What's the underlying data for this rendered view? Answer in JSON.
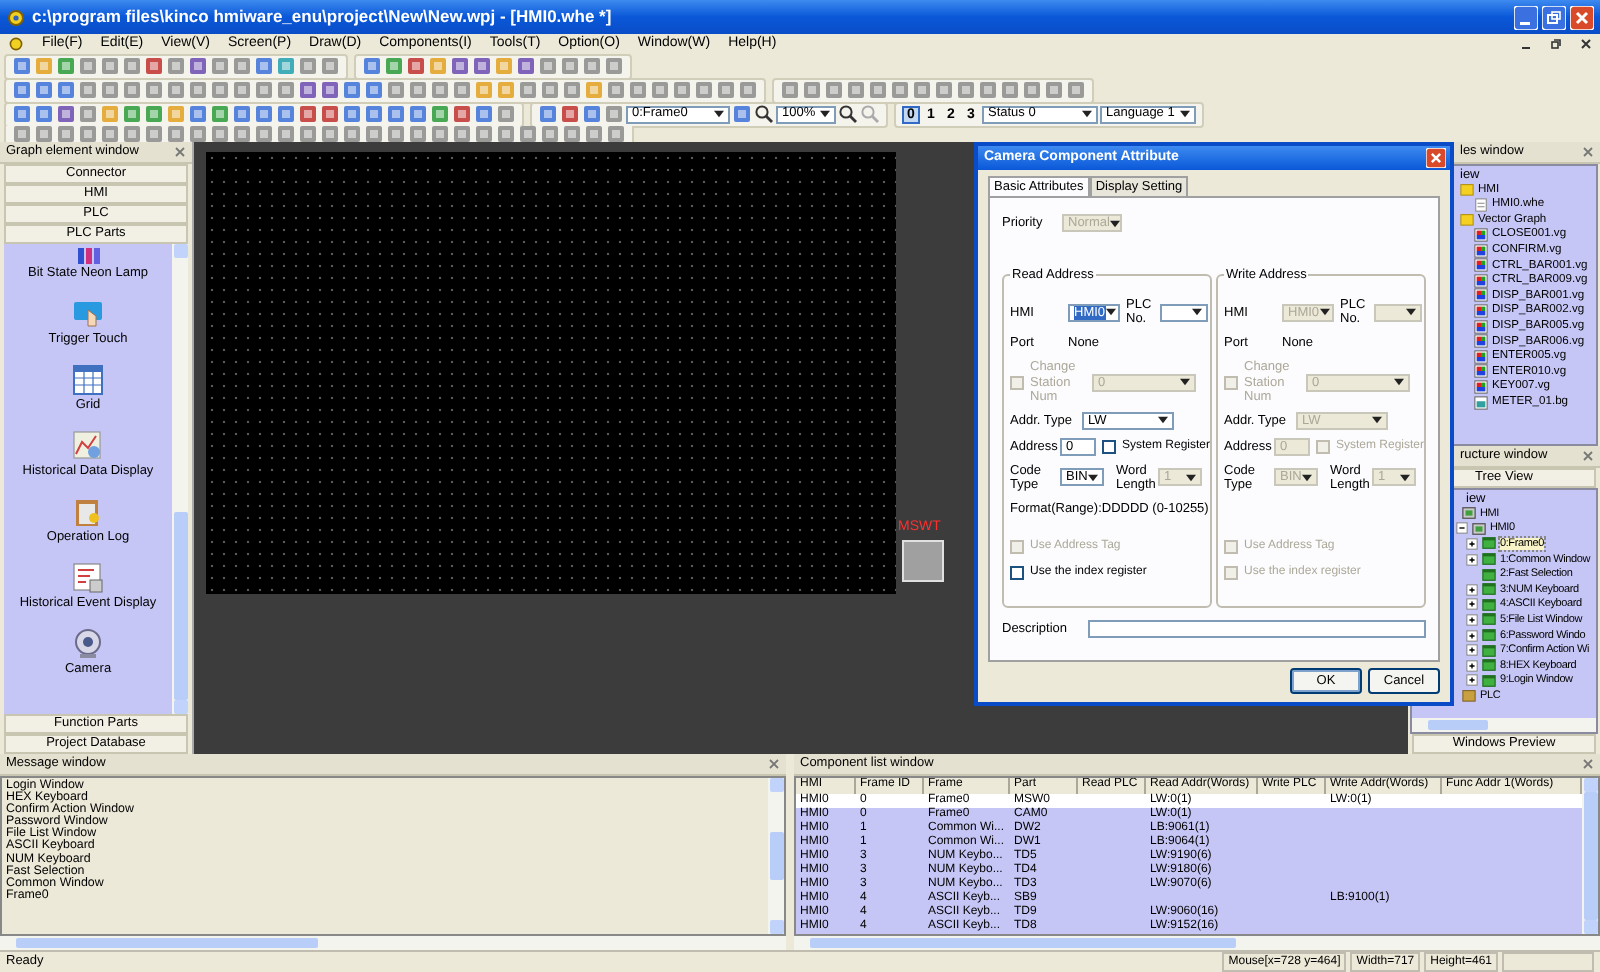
{
  "window": {
    "title": "c:\\program files\\kinco hmiware_enu\\project\\New\\New.wpj - [HMI0.whe *]"
  },
  "menu": [
    "File(F)",
    "Edit(E)",
    "View(V)",
    "Screen(P)",
    "Draw(D)",
    "Components(I)",
    "Tools(T)",
    "Option(O)",
    "Window(W)",
    "Help(H)"
  ],
  "toolbar": {
    "frame_select": "0:Frame0",
    "zoom_select": "100%",
    "layers": [
      {
        "label": "0",
        "selected": true
      },
      {
        "label": "1",
        "selected": false
      },
      {
        "label": "2",
        "selected": false
      },
      {
        "label": "3",
        "selected": false
      }
    ],
    "status_select": "Status 0",
    "language_select": "Language 1"
  },
  "graph_element_window": {
    "title": "Graph element window",
    "sections_top": [
      {
        "label": "Connector"
      },
      {
        "label": "HMI"
      },
      {
        "label": "PLC"
      },
      {
        "label": "PLC Parts"
      }
    ],
    "items": [
      {
        "label": "Bit State Neon Lamp"
      },
      {
        "label": "Trigger Touch"
      },
      {
        "label": "Grid"
      },
      {
        "label": "Historical Data Display"
      },
      {
        "label": "Operation Log"
      },
      {
        "label": "Historical Event Display"
      },
      {
        "label": "Camera"
      }
    ],
    "sections_bottom": [
      {
        "label": "Function Parts"
      },
      {
        "label": "Project Database"
      }
    ]
  },
  "canvas": {
    "widgets": [
      {
        "label": "MSWT"
      }
    ]
  },
  "dialog": {
    "title": "Camera Component Attribute",
    "tabs": [
      {
        "label": "Basic Attributes",
        "selected": true
      },
      {
        "label": "Display Setting",
        "selected": false
      }
    ],
    "priority": {
      "label": "Priority",
      "value": "Normal",
      "disabled": true
    },
    "groups": [
      {
        "title": "Read Address",
        "hmi": {
          "label": "HMI",
          "value": "HMI0",
          "disabled": false,
          "focused": true
        },
        "plc_no": {
          "label": "PLC No.",
          "disabled": false
        },
        "port": {
          "label": "Port",
          "value": "None"
        },
        "change_station": {
          "label": "Change Station Num",
          "value": "0",
          "checked": false,
          "disabled": true
        },
        "addr_type": {
          "label": "Addr. Type",
          "value": "LW",
          "disabled": false
        },
        "address": {
          "label": "Address",
          "value": "0",
          "disabled": false
        },
        "system_register": {
          "label": "System Register",
          "checked": false,
          "disabled": false
        },
        "code_type": {
          "label": "Code Type",
          "value": "BIN",
          "disabled": false
        },
        "word_length": {
          "label": "Word Length",
          "value": "1",
          "disabled": true
        },
        "format": "Format(Range):DDDDD (0-10255)",
        "use_address_tag": {
          "label": "Use Address Tag",
          "checked": false,
          "disabled": true
        },
        "index_register": {
          "label": "Use the index register",
          "checked": false,
          "disabled": false
        }
      },
      {
        "title": "Write Address",
        "hmi": {
          "label": "HMI",
          "value": "HMI0",
          "disabled": true,
          "focused": false
        },
        "plc_no": {
          "label": "PLC No.",
          "disabled": true
        },
        "port": {
          "label": "Port",
          "value": "None"
        },
        "change_station": {
          "label": "Change Station Num",
          "value": "0",
          "checked": false,
          "disabled": true
        },
        "addr_type": {
          "label": "Addr. Type",
          "value": "LW",
          "disabled": true
        },
        "address": {
          "label": "Address",
          "value": "0",
          "disabled": true
        },
        "system_register": {
          "label": "System Register",
          "checked": false,
          "disabled": true
        },
        "code_type": {
          "label": "Code Type",
          "value": "BIN",
          "disabled": true
        },
        "word_length": {
          "label": "Word Length",
          "value": "1",
          "disabled": true
        },
        "use_address_tag": {
          "label": "Use Address Tag",
          "checked": false,
          "disabled": true
        },
        "index_register": {
          "label": "Use the index register",
          "checked": false,
          "disabled": true
        }
      }
    ],
    "description": {
      "label": "Description"
    },
    "buttons": [
      "OK",
      "Cancel"
    ]
  },
  "files_window": {
    "title": "les window",
    "label": "iew",
    "tree": [
      {
        "label": "HMI",
        "kind": "folder",
        "children": [
          {
            "label": "HMI0.whe",
            "kind": "file"
          }
        ]
      },
      {
        "label": "Vector Graph",
        "kind": "folder",
        "children": [
          {
            "label": "CLOSE001.vg",
            "kind": "vector"
          },
          {
            "label": "CONFIRM.vg",
            "kind": "vector"
          },
          {
            "label": "CTRL_BAR001.vg",
            "kind": "vector"
          },
          {
            "label": "CTRL_BAR009.vg",
            "kind": "vector"
          },
          {
            "label": "DISP_BAR001.vg",
            "kind": "vector"
          },
          {
            "label": "DISP_BAR002.vg",
            "kind": "vector"
          },
          {
            "label": "DISP_BAR005.vg",
            "kind": "vector"
          },
          {
            "label": "DISP_BAR006.vg",
            "kind": "vector"
          },
          {
            "label": "ENTER005.vg",
            "kind": "vector"
          },
          {
            "label": "ENTER010.vg",
            "kind": "vector"
          },
          {
            "label": "KEY007.vg",
            "kind": "vector"
          },
          {
            "label": "METER_01.bg",
            "kind": "bitmap"
          }
        ]
      }
    ]
  },
  "structure_window": {
    "title": "ructure window",
    "tab": "Tree View",
    "label": "iew",
    "tree": [
      {
        "label": "HMI",
        "kind": "device",
        "selected": false,
        "children": [
          {
            "label": "HMI0",
            "kind": "device",
            "expanded": true,
            "selected": false,
            "children": [
              {
                "label": "0:Frame0",
                "kind": "window",
                "expanded": false,
                "selected": true
              },
              {
                "label": "1:Common Window",
                "kind": "window",
                "expanded": false,
                "selected": false
              },
              {
                "label": "2:Fast Selection",
                "kind": "window",
                "selected": false
              },
              {
                "label": "3:NUM Keyboard",
                "kind": "window",
                "expanded": false,
                "selected": false
              },
              {
                "label": "4:ASCII Keyboard",
                "kind": "window",
                "expanded": false,
                "selected": false
              },
              {
                "label": "5:File List Window",
                "kind": "window",
                "expanded": false,
                "selected": false
              },
              {
                "label": "6:Password Windo",
                "kind": "window",
                "expanded": false,
                "selected": false
              },
              {
                "label": "7:Confirm Action Wi",
                "kind": "window",
                "expanded": false,
                "selected": false
              },
              {
                "label": "8:HEX Keyboard",
                "kind": "window",
                "expanded": false,
                "selected": false
              },
              {
                "label": "9:Login Window",
                "kind": "window",
                "expanded": false,
                "selected": false
              }
            ]
          }
        ]
      },
      {
        "label": "PLC",
        "kind": "plc",
        "selected": false
      }
    ],
    "preview_button": "Windows Preview"
  },
  "message_window": {
    "title": "Message window",
    "lines": [
      "Login Window",
      "HEX Keyboard",
      "Confirm Action Window",
      "Password Window",
      "File List Window",
      "ASCII Keyboard",
      "NUM Keyboard",
      "Fast Selection",
      "Common Window",
      "Frame0"
    ]
  },
  "component_list": {
    "title": "Component list window",
    "columns": [
      "HMI",
      "Frame ID",
      "Frame",
      "Part",
      "Read PLC",
      "Read Addr(Words)",
      "Write PLC",
      "Write Addr(Words)",
      "Func Addr 1(Words)"
    ],
    "rows": [
      {
        "selected": false,
        "hmi": "HMI0",
        "frame_id": "0",
        "frame": "Frame0",
        "part": "MSW0",
        "read_addr": "LW:0(1)",
        "write_addr": "LW:0(1)"
      },
      {
        "selected": true,
        "hmi": "HMI0",
        "frame_id": "0",
        "frame": "Frame0",
        "part": "CAM0",
        "read_addr": "LW:0(1)"
      },
      {
        "selected": true,
        "hmi": "HMI0",
        "frame_id": "1",
        "frame": "Common Wi...",
        "part": "DW2",
        "read_addr": "LB:9061(1)"
      },
      {
        "selected": true,
        "hmi": "HMI0",
        "frame_id": "1",
        "frame": "Common Wi...",
        "part": "DW1",
        "read_addr": "LB:9064(1)"
      },
      {
        "selected": true,
        "hmi": "HMI0",
        "frame_id": "3",
        "frame": "NUM Keybo...",
        "part": "TD5",
        "read_addr": "LW:9190(6)"
      },
      {
        "selected": true,
        "hmi": "HMI0",
        "frame_id": "3",
        "frame": "NUM Keybo...",
        "part": "TD4",
        "read_addr": "LW:9180(6)"
      },
      {
        "selected": true,
        "hmi": "HMI0",
        "frame_id": "3",
        "frame": "NUM Keybo...",
        "part": "TD3",
        "read_addr": "LW:9070(6)"
      },
      {
        "selected": true,
        "hmi": "HMI0",
        "frame_id": "4",
        "frame": "ASCII Keyb...",
        "part": "SB9",
        "write_addr": "LB:9100(1)"
      },
      {
        "selected": true,
        "hmi": "HMI0",
        "frame_id": "4",
        "frame": "ASCII Keyb...",
        "part": "TD9",
        "read_addr": "LW:9060(16)"
      },
      {
        "selected": true,
        "hmi": "HMI0",
        "frame_id": "4",
        "frame": "ASCII Keyb...",
        "part": "TD8",
        "read_addr": "LW:9152(16)"
      }
    ]
  },
  "status_bar": {
    "message": "Ready",
    "mouse": "Mouse[x=728  y=464]",
    "width": "Width=717",
    "height": "Height=461"
  }
}
